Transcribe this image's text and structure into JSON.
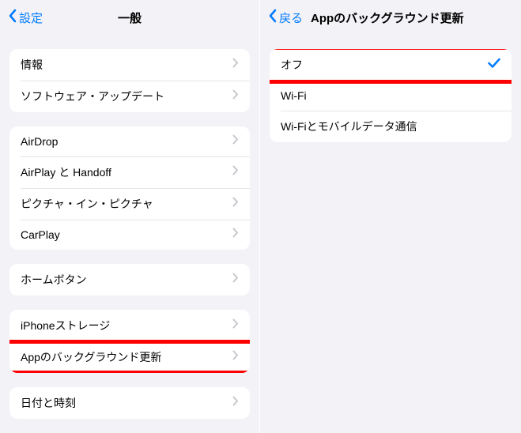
{
  "left": {
    "nav": {
      "back": "設定",
      "title": "一般"
    },
    "groups": [
      {
        "rows": [
          {
            "label": "情報"
          },
          {
            "label": "ソフトウェア・アップデート"
          }
        ]
      },
      {
        "rows": [
          {
            "label": "AirDrop"
          },
          {
            "label": "AirPlay と Handoff"
          },
          {
            "label": "ピクチャ・イン・ピクチャ"
          },
          {
            "label": "CarPlay"
          }
        ]
      },
      {
        "rows": [
          {
            "label": "ホームボタン"
          }
        ]
      },
      {
        "rows": [
          {
            "label": "iPhoneストレージ"
          },
          {
            "label": "Appのバックグラウンド更新",
            "highlight": true
          }
        ]
      },
      {
        "rows": [
          {
            "label": "日付と時刻"
          }
        ]
      }
    ]
  },
  "right": {
    "nav": {
      "back": "戻る",
      "title": "Appのバックグラウンド更新"
    },
    "options": [
      {
        "label": "オフ",
        "selected": true,
        "highlight": true
      },
      {
        "label": "Wi-Fi",
        "selected": false
      },
      {
        "label": "Wi-Fiとモバイルデータ通信",
        "selected": false
      }
    ]
  }
}
